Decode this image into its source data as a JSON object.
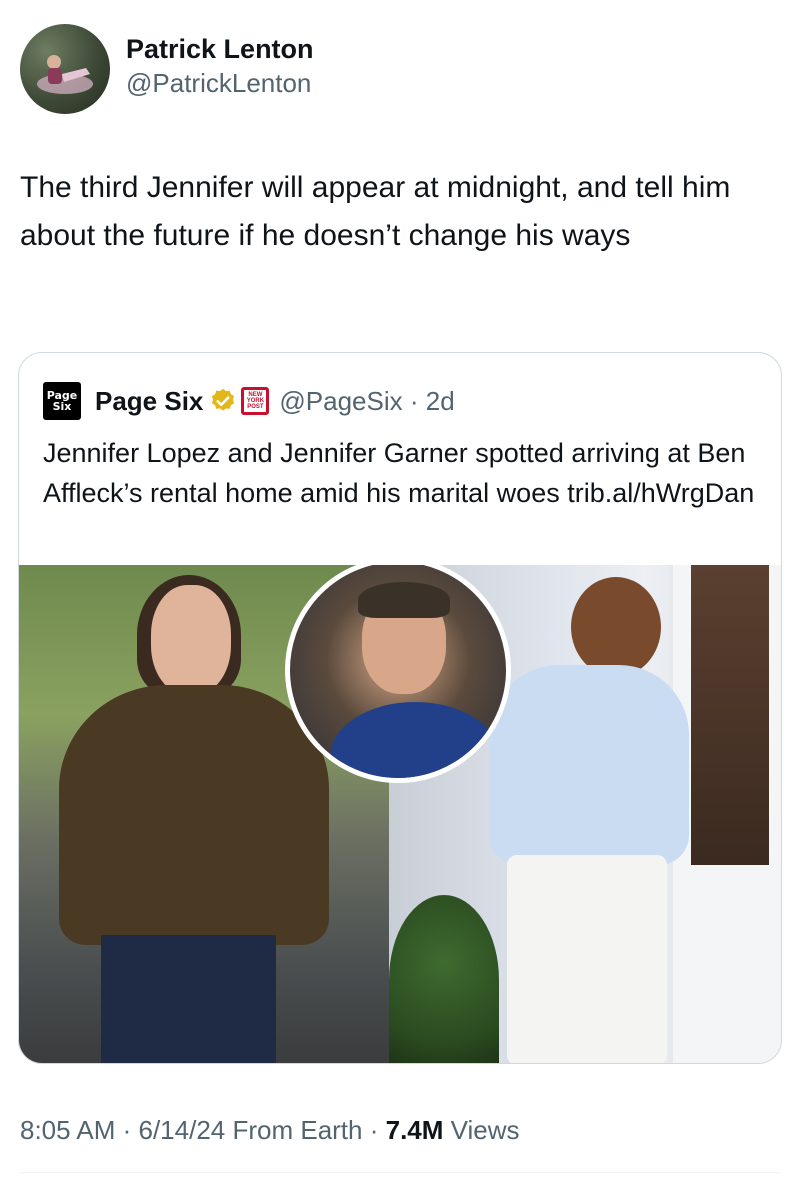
{
  "author": {
    "name": "Patrick Lenton",
    "handle": "@PatrickLenton"
  },
  "tweet": {
    "text": "The third Jennifer will appear at midnight, and tell him about the future if he doesn’t change his ways"
  },
  "quoted": {
    "logo_text_line1": "Page",
    "logo_text_line2": "Six",
    "name": "Page Six",
    "affiliate_badge_line1": "NEW",
    "affiliate_badge_line2": "YORK",
    "affiliate_badge_line3": "POST",
    "handle_time": "@PageSix · 2d",
    "text": "Jennifer Lopez and Jennifer Garner spotted arriving at Ben Affleck’s rental home amid his marital woes trib.al/hWrgDan"
  },
  "meta": {
    "time_date": "8:05 AM · 6/14/24 From Earth · ",
    "views_count": "7.4M",
    "views_label": " Views"
  },
  "colors": {
    "verified_gold": "#e2b719",
    "nyp_red": "#c8102e",
    "secondary_text": "#536471",
    "border": "#cfd9de"
  },
  "icons": {
    "verified": "verified-gold-badge-icon",
    "affiliate": "new-york-post-badge-icon"
  }
}
